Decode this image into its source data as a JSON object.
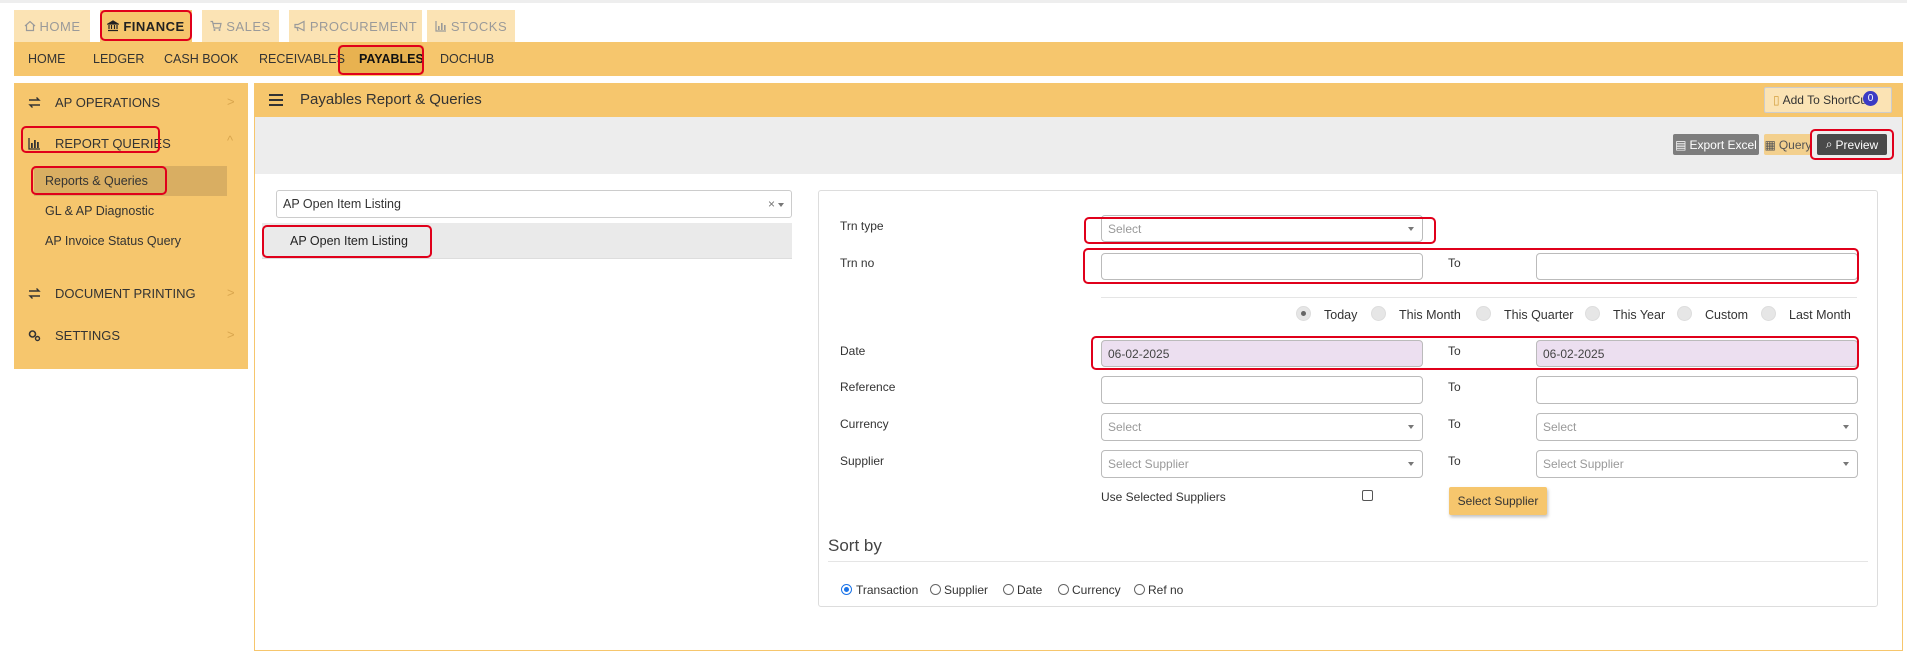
{
  "top_tabs": [
    {
      "label": "HOME",
      "icon": "home-icon"
    },
    {
      "label": "FINANCE",
      "icon": "bank-icon"
    },
    {
      "label": "SALES",
      "icon": "cart-icon"
    },
    {
      "label": "PROCUREMENT",
      "icon": "megaphone-icon"
    },
    {
      "label": "STOCKS",
      "icon": "bar-chart-icon"
    }
  ],
  "menu": [
    "HOME",
    "LEDGER",
    "CASH BOOK",
    "RECEIVABLES",
    "PAYABLES",
    "DOCHUB"
  ],
  "sidebar": {
    "sections": [
      {
        "label": "AP OPERATIONS",
        "icon": "exchange-icon"
      },
      {
        "label": "REPORT QUERIES",
        "icon": "bar-chart-icon"
      },
      {
        "label": "DOCUMENT PRINTING",
        "icon": "exchange-icon"
      },
      {
        "label": "SETTINGS",
        "icon": "gears-icon"
      }
    ],
    "sub_items": [
      "Reports & Queries",
      "GL & AP Diagnostic",
      "AP Invoice Status Query"
    ]
  },
  "page": {
    "title": "Payables Report & Queries",
    "shortcut_label": "Add To ShortCut",
    "shortcut_count": "0",
    "export_label": "Export Excel",
    "query_label": "Query",
    "preview_label": "Preview"
  },
  "report_list": {
    "selected_value": "AP Open Item Listing",
    "clear_symbol": "×",
    "items": [
      "AP Open Item Listing"
    ]
  },
  "form": {
    "trn_type_label": "Trn type",
    "trn_type_placeholder": "Select",
    "trn_no_label": "Trn no",
    "to_label": "To",
    "period_options": [
      "Today",
      "This Month",
      "This Quarter",
      "This Year",
      "Custom",
      "Last Month"
    ],
    "period_selected": "Today",
    "date_label": "Date",
    "date_from": "06-02-2025",
    "date_to": "06-02-2025",
    "reference_label": "Reference",
    "currency_label": "Currency",
    "currency_placeholder": "Select",
    "supplier_label": "Supplier",
    "supplier_placeholder": "Select Supplier",
    "use_selected_label": "Use Selected Suppliers",
    "select_supplier_button": "Select Supplier"
  },
  "sort": {
    "heading": "Sort by",
    "options": [
      "Transaction",
      "Supplier",
      "Date",
      "Currency",
      "Ref no"
    ],
    "selected": "Transaction"
  },
  "colors": {
    "accent": "#f6c66d",
    "highlight": "#e0001b",
    "date_bg": "#ecdff0"
  }
}
